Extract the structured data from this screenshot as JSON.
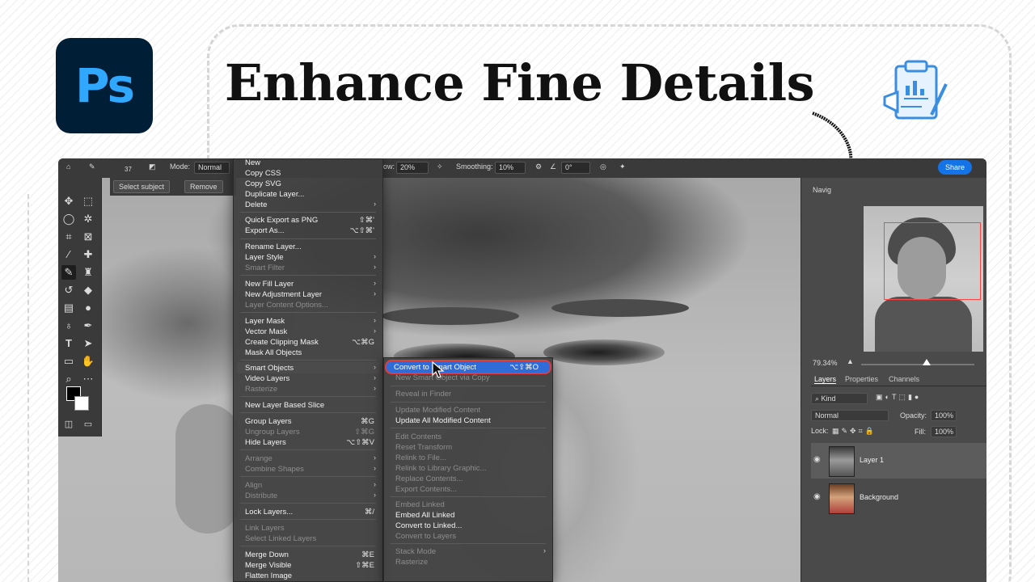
{
  "headline": "Enhance Fine Details",
  "logo_text": "Ps",
  "colors": {
    "ps_bg": "#001e36",
    "ps_text": "#31a8ff",
    "highlight_border": "#e23b3b",
    "highlight_bg": "#2f6cd8",
    "share": "#1473e6"
  },
  "options_bar": {
    "size": "37",
    "mode_label": "Mode:",
    "mode_value": "Normal",
    "flow_label": "ow:",
    "flow_value": "20%",
    "smoothing_label": "Smoothing:",
    "smoothing_value": "10%",
    "angle_value": "0°",
    "share_label": "Share"
  },
  "select_bar": {
    "select_subject": "Select subject",
    "remove": "Remove"
  },
  "context_menu": {
    "items": [
      {
        "label": "New",
        "disabled": false
      },
      {
        "label": "Copy CSS",
        "disabled": false
      },
      {
        "label": "Copy SVG",
        "disabled": false
      },
      {
        "label": "Duplicate Layer...",
        "disabled": false
      },
      {
        "label": "Delete",
        "disabled": false,
        "submenu": true
      },
      {
        "label": "Quick Export as PNG",
        "shortcut": "⇧⌘'",
        "disabled": false
      },
      {
        "label": "Export As...",
        "shortcut": "⌥⇧⌘'",
        "disabled": false
      },
      {
        "label": "Rename Layer...",
        "disabled": false
      },
      {
        "label": "Layer Style",
        "disabled": false,
        "submenu": true
      },
      {
        "label": "Smart Filter",
        "disabled": true,
        "submenu": true
      },
      {
        "label": "New Fill Layer",
        "disabled": false,
        "submenu": true
      },
      {
        "label": "New Adjustment Layer",
        "disabled": false,
        "submenu": true
      },
      {
        "label": "Layer Content Options...",
        "disabled": true
      },
      {
        "label": "Layer Mask",
        "disabled": false,
        "submenu": true
      },
      {
        "label": "Vector Mask",
        "disabled": false,
        "submenu": true
      },
      {
        "label": "Create Clipping Mask",
        "shortcut": "⌥⌘G",
        "disabled": false
      },
      {
        "label": "Mask All Objects",
        "disabled": false
      },
      {
        "label": "Smart Objects",
        "disabled": false,
        "submenu": true
      },
      {
        "label": "Video Layers",
        "disabled": false,
        "submenu": true
      },
      {
        "label": "Rasterize",
        "disabled": true,
        "submenu": true
      },
      {
        "label": "New Layer Based Slice",
        "disabled": false
      },
      {
        "label": "Group Layers",
        "shortcut": "⌘G",
        "disabled": false
      },
      {
        "label": "Ungroup Layers",
        "shortcut": "⇧⌘G",
        "disabled": true
      },
      {
        "label": "Hide Layers",
        "shortcut": "⌥⇧⌘V",
        "disabled": false
      },
      {
        "label": "Arrange",
        "disabled": true,
        "submenu": true
      },
      {
        "label": "Combine Shapes",
        "disabled": true,
        "submenu": true
      },
      {
        "label": "Align",
        "disabled": true,
        "submenu": true
      },
      {
        "label": "Distribute",
        "disabled": true,
        "submenu": true
      },
      {
        "label": "Lock Layers...",
        "shortcut": "⌘/",
        "disabled": false
      },
      {
        "label": "Link Layers",
        "disabled": true
      },
      {
        "label": "Select Linked Layers",
        "disabled": true
      },
      {
        "label": "Merge Down",
        "shortcut": "⌘E",
        "disabled": false
      },
      {
        "label": "Merge Visible",
        "shortcut": "⇧⌘E",
        "disabled": false
      },
      {
        "label": "Flatten Image",
        "disabled": false
      }
    ]
  },
  "submenu": {
    "convert_label": "Convert to Smart Object",
    "convert_shortcut": "⌥⇧⌘O",
    "items": [
      {
        "label": "New Smart Object via Copy",
        "disabled": true
      },
      {
        "label": "Reveal in Finder",
        "disabled": true
      },
      {
        "label": "Update Modified Content",
        "disabled": true
      },
      {
        "label": "Update All Modified Content",
        "disabled": false
      },
      {
        "label": "Edit Contents",
        "disabled": true
      },
      {
        "label": "Reset Transform",
        "disabled": true
      },
      {
        "label": "Relink to File...",
        "disabled": true
      },
      {
        "label": "Relink to Library Graphic...",
        "disabled": true
      },
      {
        "label": "Replace Contents...",
        "disabled": true
      },
      {
        "label": "Export Contents...",
        "disabled": true
      },
      {
        "label": "Embed Linked",
        "disabled": true
      },
      {
        "label": "Embed All Linked",
        "disabled": false
      },
      {
        "label": "Convert to Linked...",
        "disabled": false
      },
      {
        "label": "Convert to Layers",
        "disabled": true
      },
      {
        "label": "Stack Mode",
        "disabled": true
      },
      {
        "label": "Rasterize",
        "disabled": true
      }
    ]
  },
  "navigator": {
    "tab": "Navig",
    "zoom": "79.34%"
  },
  "layers_panel": {
    "tabs": [
      "Layers",
      "Properties",
      "Channels"
    ],
    "kind": "Kind",
    "blend_mode": "Normal",
    "opacity_label": "Opacity:",
    "opacity_value": "100%",
    "lock_label": "Lock:",
    "fill_label": "Fill:",
    "fill_value": "100%",
    "layers": [
      "Layer 1",
      "Background"
    ]
  }
}
